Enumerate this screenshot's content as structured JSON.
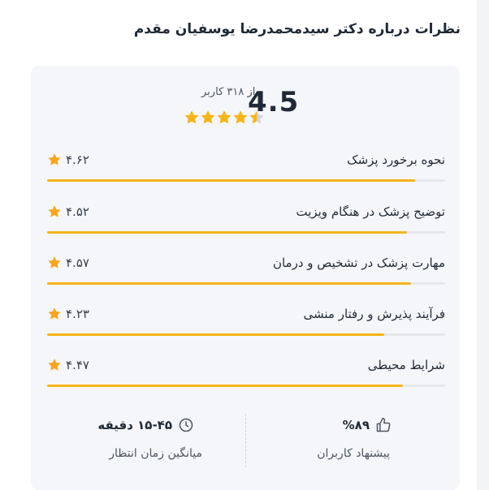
{
  "header": {
    "title": "نظرات درباره دکتر سیدمحمدرضا یوسفیان مقدم"
  },
  "summary": {
    "score": "4.5",
    "score_value": 4.5,
    "count_text": "از ۳۱۸ کاربر",
    "star_color": "#f6b41a"
  },
  "ratings": [
    {
      "label": "نحوه برخورد پزشک",
      "value_text": "۴.۶۲",
      "value": 4.62
    },
    {
      "label": "توضیح پزشک در هنگام ویزیت",
      "value_text": "۴.۵۲",
      "value": 4.52
    },
    {
      "label": "مهارت پزشک در تشخیص و درمان",
      "value_text": "۴.۵۷",
      "value": 4.57
    },
    {
      "label": "فرآیند پذیرش و رفتار منشی",
      "value_text": "۴.۲۳",
      "value": 4.23
    },
    {
      "label": "شرایط محیطی",
      "value_text": "۴.۴۷",
      "value": 4.47
    }
  ],
  "footer": {
    "recommend": {
      "value": "%۸۹",
      "label": "پیشنهاد کاربران",
      "icon": "thumbs-up-icon"
    },
    "wait": {
      "value": "۱۵-۴۵ دقیقه",
      "label": "میانگین زمان انتظار",
      "icon": "clock-icon"
    }
  }
}
